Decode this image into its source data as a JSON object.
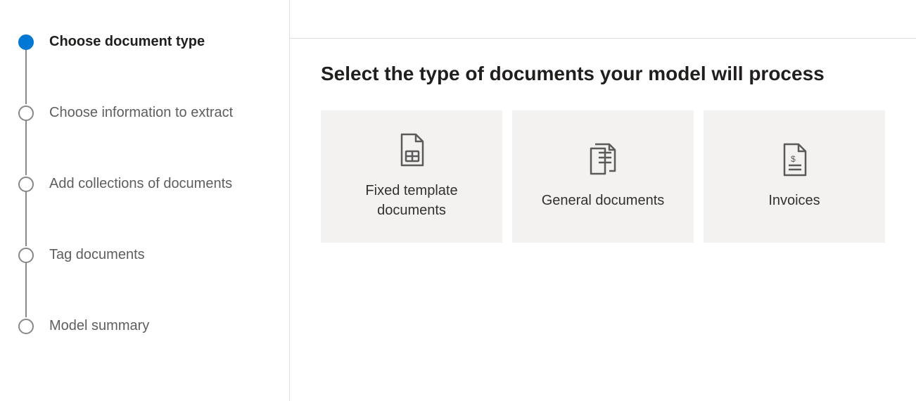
{
  "sidebar": {
    "steps": [
      {
        "label": "Choose document type",
        "active": true
      },
      {
        "label": "Choose information to extract",
        "active": false
      },
      {
        "label": "Add collections of documents",
        "active": false
      },
      {
        "label": "Tag documents",
        "active": false
      },
      {
        "label": "Model summary",
        "active": false
      }
    ]
  },
  "main": {
    "title": "Select the type of documents your model will process",
    "cards": [
      {
        "label": "Fixed template documents",
        "icon": "document-template-icon"
      },
      {
        "label": "General documents",
        "icon": "document-general-icon"
      },
      {
        "label": "Invoices",
        "icon": "document-invoice-icon"
      }
    ]
  }
}
